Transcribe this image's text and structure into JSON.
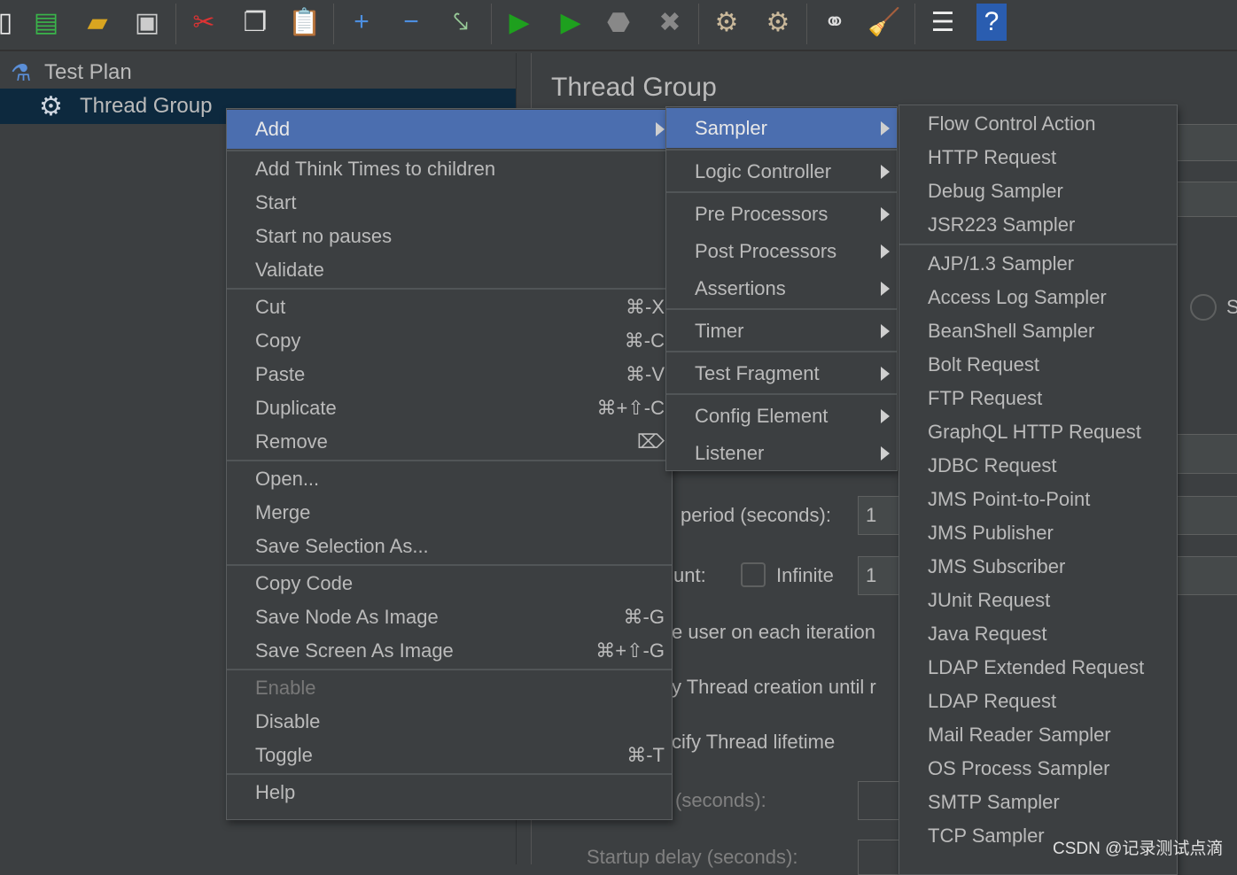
{
  "toolbar": {
    "icons": [
      "new-icon",
      "templates-icon",
      "open-icon",
      "save-icon",
      "cut-icon",
      "copy-icon",
      "paste-icon",
      "expand-icon",
      "collapse-icon",
      "toggle-icon",
      "start-icon",
      "start-no-pauses-icon",
      "stop-icon",
      "shutdown-icon",
      "clear-icon",
      "clear-all-icon",
      "search-icon",
      "reset-search-icon",
      "function-helper-icon",
      "help-icon"
    ]
  },
  "tree": {
    "items": [
      {
        "label": "Test Plan"
      },
      {
        "label": "Thread Group",
        "selected": true
      }
    ]
  },
  "panel": {
    "title": "Thread Group",
    "rampup_label": "period (seconds):",
    "rampup_value": "1",
    "loop_label": "unt:",
    "infinite_label": "Infinite",
    "loop_value": "1",
    "same_user_label": "e user on each iteration",
    "delay_label": "y Thread creation until r",
    "lifetime_label": "cify Thread lifetime",
    "duration_label": "(seconds):",
    "startup_label": "Startup delay (seconds):",
    "radio_label": "S"
  },
  "context_menu": {
    "groups": [
      [
        {
          "label": "Add",
          "submenu": true,
          "highlighted": true
        }
      ],
      [
        {
          "label": "Add Think Times to children"
        },
        {
          "label": "Start"
        },
        {
          "label": "Start no pauses"
        },
        {
          "label": "Validate"
        }
      ],
      [
        {
          "label": "Cut",
          "shortcut": "⌘-X"
        },
        {
          "label": "Copy",
          "shortcut": "⌘-C"
        },
        {
          "label": "Paste",
          "shortcut": "⌘-V"
        },
        {
          "label": "Duplicate",
          "shortcut": "⌘+⇧-C"
        },
        {
          "label": "Remove",
          "shortcut": "⌦"
        }
      ],
      [
        {
          "label": "Open..."
        },
        {
          "label": "Merge"
        },
        {
          "label": "Save Selection As..."
        }
      ],
      [
        {
          "label": "Copy Code"
        },
        {
          "label": "Save Node As Image",
          "shortcut": "⌘-G"
        },
        {
          "label": "Save Screen As Image",
          "shortcut": "⌘+⇧-G"
        }
      ],
      [
        {
          "label": "Enable",
          "disabled": true
        },
        {
          "label": "Disable"
        },
        {
          "label": "Toggle",
          "shortcut": "⌘-T"
        }
      ],
      [
        {
          "label": "Help"
        }
      ]
    ]
  },
  "add_menu": {
    "groups": [
      [
        {
          "label": "Sampler",
          "submenu": true,
          "highlighted": true
        }
      ],
      [
        {
          "label": "Logic Controller",
          "submenu": true
        }
      ],
      [
        {
          "label": "Pre Processors",
          "submenu": true
        },
        {
          "label": "Post Processors",
          "submenu": true
        },
        {
          "label": "Assertions",
          "submenu": true
        }
      ],
      [
        {
          "label": "Timer",
          "submenu": true
        }
      ],
      [
        {
          "label": "Test Fragment",
          "submenu": true
        }
      ],
      [
        {
          "label": "Config Element",
          "submenu": true
        },
        {
          "label": "Listener",
          "submenu": true
        }
      ]
    ]
  },
  "sampler_menu": {
    "groups": [
      [
        {
          "label": "Flow Control Action"
        },
        {
          "label": "HTTP Request"
        },
        {
          "label": "Debug Sampler"
        },
        {
          "label": "JSR223 Sampler"
        }
      ],
      [
        {
          "label": "AJP/1.3 Sampler"
        },
        {
          "label": "Access Log Sampler"
        },
        {
          "label": "BeanShell Sampler"
        },
        {
          "label": "Bolt Request"
        },
        {
          "label": "FTP Request"
        },
        {
          "label": "GraphQL HTTP Request"
        },
        {
          "label": "JDBC Request"
        },
        {
          "label": "JMS Point-to-Point"
        },
        {
          "label": "JMS Publisher"
        },
        {
          "label": "JMS Subscriber"
        },
        {
          "label": "JUnit Request"
        },
        {
          "label": "Java Request"
        },
        {
          "label": "LDAP Extended Request"
        },
        {
          "label": "LDAP Request"
        },
        {
          "label": "Mail Reader Sampler"
        },
        {
          "label": "OS Process Sampler"
        },
        {
          "label": "SMTP Sampler"
        },
        {
          "label": "TCP Sampler"
        }
      ]
    ]
  },
  "watermark": "CSDN @记录测试点滴",
  "colors": {
    "background": "#3c3f41",
    "highlight": "#4b6eaf",
    "tree_selection": "#0d293e",
    "text": "#bbbbbb"
  }
}
